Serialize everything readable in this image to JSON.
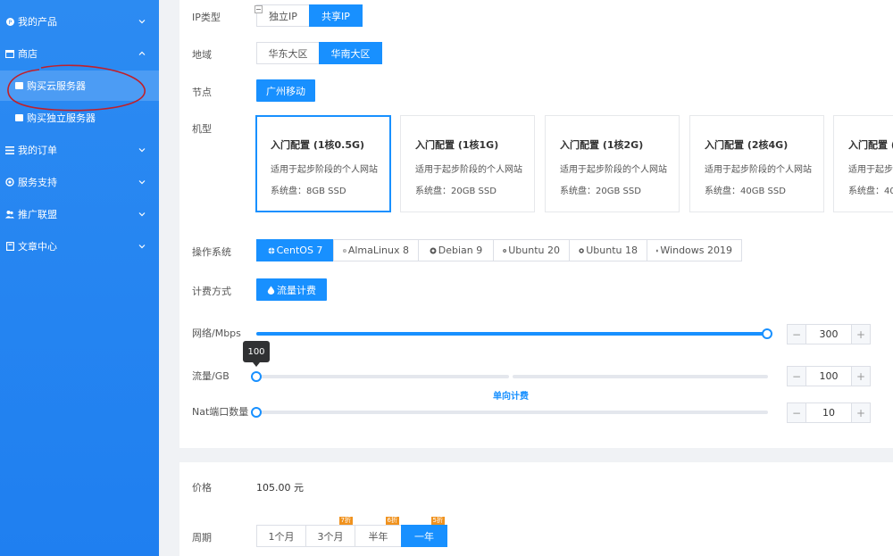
{
  "sidebar": {
    "items": [
      {
        "label": "我的产品"
      },
      {
        "label": "商店"
      },
      {
        "label": "我的订单"
      },
      {
        "label": "服务支持"
      },
      {
        "label": "推广联盟"
      },
      {
        "label": "文章中心"
      }
    ],
    "sub_items": [
      {
        "label": "购买云服务器"
      },
      {
        "label": "购买独立服务器"
      }
    ],
    "accent_color": "#1f7ff0"
  },
  "config": {
    "ip_type": {
      "label": "IP类型",
      "options": [
        "独立IP",
        "共享IP"
      ],
      "selected": "共享IP"
    },
    "region": {
      "label": "地域",
      "options": [
        "华东大区",
        "华南大区"
      ],
      "selected": "华南大区"
    },
    "node": {
      "label": "节点",
      "value": "广州移动"
    },
    "model": {
      "label": "机型",
      "cards": [
        {
          "title": "入门配置 (1核0.5G)",
          "desc": "适用于起步阶段的个人网站",
          "disk": "系统盘：8GB SSD"
        },
        {
          "title": "入门配置 (1核1G)",
          "desc": "适用于起步阶段的个人网站",
          "disk": "系统盘：20GB SSD"
        },
        {
          "title": "入门配置 (1核2G)",
          "desc": "适用于起步阶段的个人网站",
          "disk": "系统盘：20GB SSD"
        },
        {
          "title": "入门配置 (2核4G)",
          "desc": "适用于起步阶段的个人网站",
          "disk": "系统盘：40GB SSD"
        },
        {
          "title": "入门配置 (",
          "desc": "适用于起步阶",
          "disk": "系统盘：40("
        }
      ],
      "selected_index": 0
    },
    "os": {
      "label": "操作系统",
      "options": [
        {
          "label": "CentOS 7",
          "icon": "centos-icon"
        },
        {
          "label": "AlmaLinux 8",
          "icon": "almalinux-icon"
        },
        {
          "label": "Debian 9",
          "icon": "debian-icon"
        },
        {
          "label": "Ubuntu 20",
          "icon": "ubuntu-icon"
        },
        {
          "label": "Ubuntu 18",
          "icon": "ubuntu-icon"
        },
        {
          "label": "Windows 2019",
          "icon": "windows-icon"
        }
      ],
      "selected": "CentOS 7"
    },
    "billing": {
      "label": "计费方式",
      "value": "流量计费",
      "icon": "drop-icon"
    },
    "network": {
      "label": "网络/Mbps",
      "value": "300",
      "fraction": 1.0
    },
    "traffic": {
      "label": "流量/GB",
      "value": "100",
      "tooltip": "100",
      "fraction": 0.0,
      "note": "单向计费"
    },
    "nat": {
      "label": "Nat端口数量",
      "value": "10",
      "fraction": 0.0
    }
  },
  "order": {
    "price": {
      "label": "价格",
      "value": "105.00 元"
    },
    "period": {
      "label": "周期",
      "options": [
        {
          "label": "1个月",
          "badge": ""
        },
        {
          "label": "3个月",
          "badge": "7折"
        },
        {
          "label": "半年",
          "badge": "6折"
        },
        {
          "label": "一年",
          "badge": "5折"
        }
      ],
      "selected": "一年"
    }
  },
  "stepper": {
    "minus": "−",
    "plus": "+"
  }
}
